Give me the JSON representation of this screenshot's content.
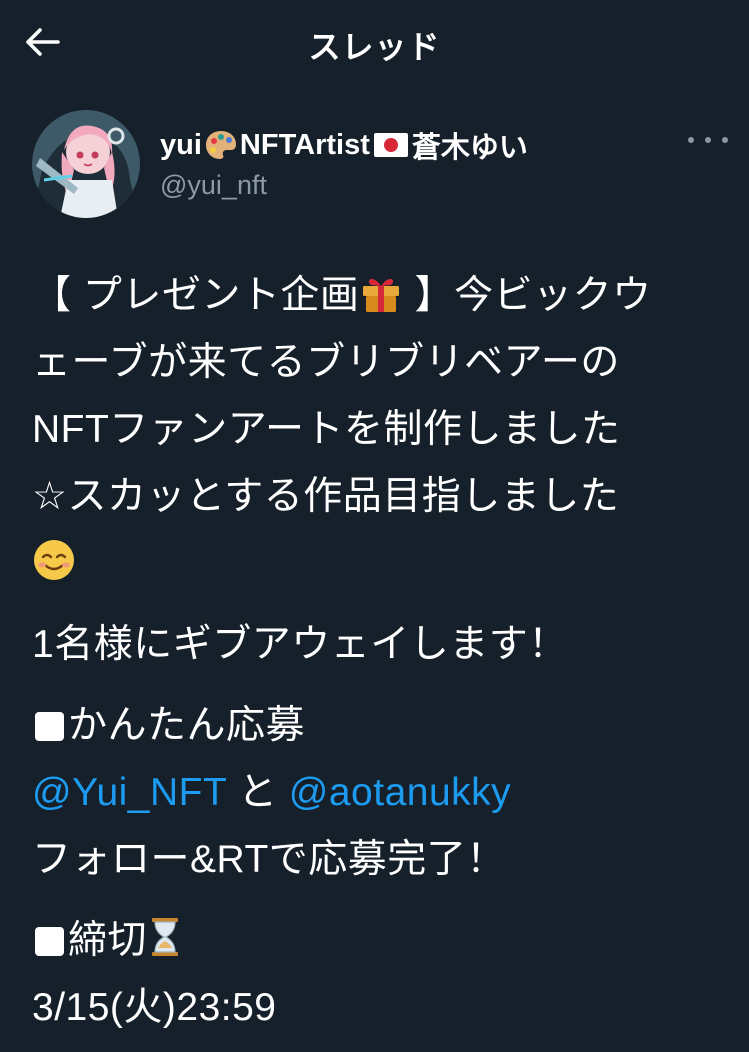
{
  "header": {
    "title": "スレッド",
    "back_icon": "arrow-left-icon"
  },
  "author": {
    "name_prefix": "yui",
    "name_middle": "NFTArtist",
    "name_suffix": "蒼木ゆい",
    "name_emojis": [
      "palette-icon",
      "japan-flag-icon"
    ],
    "handle": "@yui_nft",
    "more_icon": "more-horizontal-icon"
  },
  "tweet": {
    "line1_a": "【 プレゼント企画",
    "line1_b": " 】今ビックウ",
    "line2": "ェーブが来てるブリブリベアーの",
    "line3": "NFTファンアートを制作しました",
    "line4": "☆スカッとする作品目指しました",
    "line6": "1名様にギブアウェイします！",
    "line7": "かんたん応募",
    "mention1": "@Yui_NFT",
    "connector": " と ",
    "mention2": "@aotanukky",
    "line9": "フォロー&RTで応募完了！",
    "line10": "締切",
    "line11": "3/15(火)23:59"
  },
  "colors": {
    "background": "#15202b",
    "text": "#ffffff",
    "secondary": "#8b98a5",
    "link": "#1d9bf0"
  }
}
